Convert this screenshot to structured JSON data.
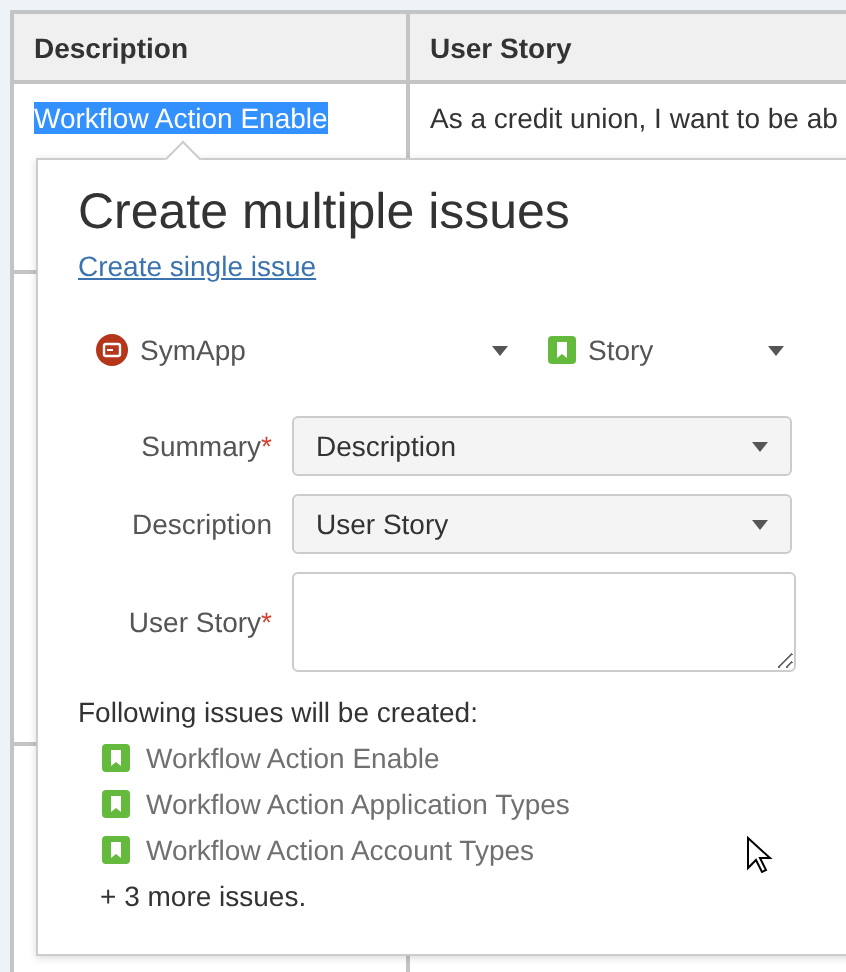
{
  "table": {
    "columns": [
      "Description",
      "User Story"
    ],
    "rows": [
      {
        "cells": [
          "Workflow Action Enable",
          "As a credit union, I want to be ab"
        ],
        "selected": true
      }
    ]
  },
  "popup": {
    "title": "Create multiple issues",
    "link": "Create single issue",
    "required_marker": "*",
    "project": {
      "name": "SymApp"
    },
    "issue_type": {
      "name": "Story"
    },
    "fields": [
      {
        "label": "Summary",
        "required": true,
        "kind": "select",
        "value": "Description"
      },
      {
        "label": "Description",
        "required": false,
        "kind": "select",
        "value": "User Story"
      },
      {
        "label": "User Story",
        "required": true,
        "kind": "textarea"
      }
    ],
    "preview": {
      "heading": "Following issues will be created:",
      "issues": [
        "Workflow Action Enable",
        "Workflow Action Application Types",
        "Workflow Action Account Types"
      ],
      "more": "+ 3 more issues."
    }
  }
}
